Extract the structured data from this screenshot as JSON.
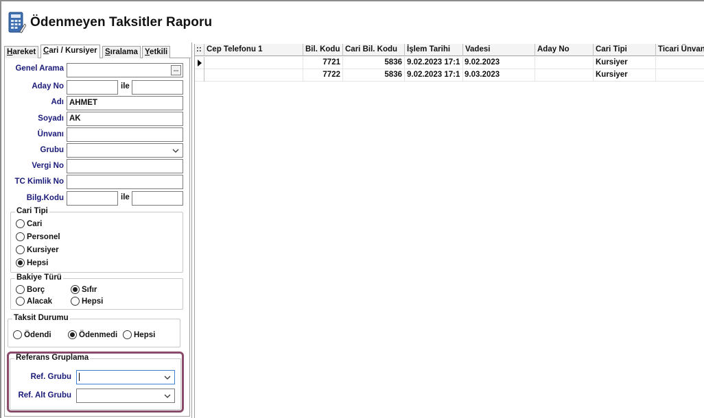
{
  "window": {
    "title": "Ödenmeyen Taksitler Raporu",
    "icon": "report-calculator-icon"
  },
  "tabs": [
    {
      "prefix": "",
      "ul": "H",
      "rest": "areket"
    },
    {
      "prefix": "",
      "ul": "C",
      "rest": "ari / Kursiyer"
    },
    {
      "prefix": "",
      "ul": "S",
      "rest": "ıralama"
    },
    {
      "prefix": "",
      "ul": "Y",
      "rest": "etkili"
    }
  ],
  "active_tab": 1,
  "filters": {
    "genel_arama": {
      "label": "Genel Arama",
      "value": ""
    },
    "aday_no": {
      "label": "Aday No",
      "from": "",
      "sep": "ile",
      "to": ""
    },
    "adi": {
      "label": "Adı",
      "value": "AHMET"
    },
    "soyadi": {
      "label": "Soyadı",
      "value": "AK"
    },
    "unvani": {
      "label": "Ünvanı",
      "value": ""
    },
    "grubu": {
      "label": "Grubu",
      "value": ""
    },
    "vergi_no": {
      "label": "Vergi No",
      "value": ""
    },
    "tc_kimlik_no": {
      "label": "TC Kimlik No",
      "value": ""
    },
    "bilg_kodu": {
      "label": "Bilg.Kodu",
      "from": "",
      "sep": "ile",
      "to": ""
    }
  },
  "cari_tipi": {
    "legend": "Cari Tipi",
    "options": [
      "Cari",
      "Personel",
      "Kursiyer",
      "Hepsi"
    ],
    "selected": "Hepsi"
  },
  "bakiye_turu": {
    "legend": "Bakiye Türü",
    "options": [
      "Borç",
      "Sıfır",
      "Alacak",
      "Hepsi"
    ],
    "selected": "Sıfır"
  },
  "taksit_durumu": {
    "legend": "Taksit Durumu",
    "options": [
      "Ödendi",
      "Ödenmedi",
      "Hepsi"
    ],
    "selected": "Ödenmedi"
  },
  "referans_gruplama": {
    "legend": "Referans Gruplama",
    "ref_grubu": {
      "label": "Ref. Grubu",
      "value": ""
    },
    "ref_alt_grubu": {
      "label": "Ref. Alt Grubu",
      "value": ""
    },
    "highlight_color": "#8a4a6a"
  },
  "grid": {
    "corner": "::",
    "columns": [
      "Cep Telefonu 1",
      "Bil. Kodu",
      "Cari Bil. Kodu",
      "İşlem Tarihi",
      "Vadesi",
      "Aday No",
      "Cari Tipi",
      "Ticari Ünvanı"
    ],
    "rows": [
      {
        "cep": "",
        "bil_kodu": "7721",
        "cari_bil_kodu": "5836",
        "islem_tarihi": "9.02.2023 17:1",
        "vadesi": "9.02.2023",
        "aday_no": "",
        "cari_tipi": "Kursiyer",
        "ticari_unvani": ""
      },
      {
        "cep": "",
        "bil_kodu": "7722",
        "cari_bil_kodu": "5836",
        "islem_tarihi": "9.02.2023 17:1",
        "vadesi": "9.03.2023",
        "aday_no": "",
        "cari_tipi": "Kursiyer",
        "ticari_unvani": ""
      }
    ],
    "current_row": 0
  }
}
